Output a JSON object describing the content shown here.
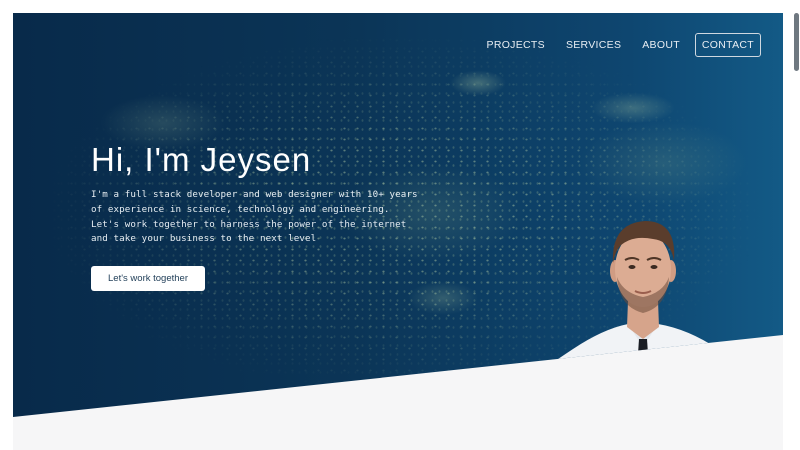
{
  "nav": {
    "items": [
      {
        "label": "PROJECTS"
      },
      {
        "label": "SERVICES"
      },
      {
        "label": "ABOUT"
      },
      {
        "label": "CONTACT"
      }
    ]
  },
  "hero": {
    "heading": "Hi, I'm Jeysen",
    "intro": "I'm a full stack developer and web designer with 10+ years of experience in science, technology and engineering. Let's work together to harness the power of the internet and take your business to the next level",
    "cta_label": "Let's work together"
  },
  "colors": {
    "hero_bg_dark": "#082a4a",
    "hero_bg_light": "#135a86",
    "page_bg": "#f6f6f7",
    "button_bg": "#ffffff"
  }
}
